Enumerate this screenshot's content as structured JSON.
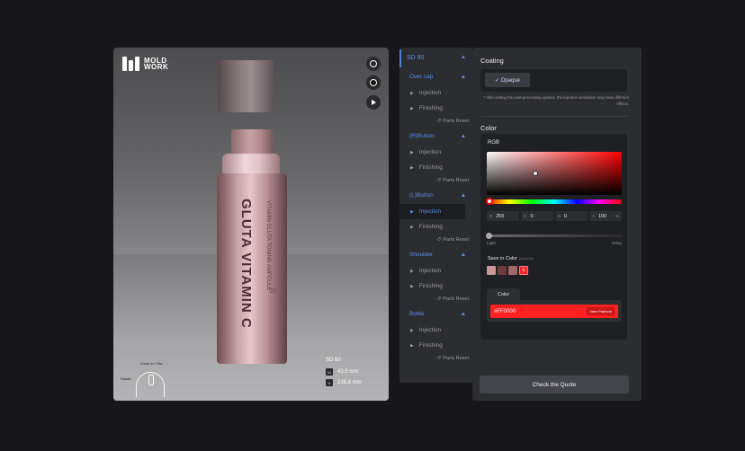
{
  "brand": {
    "line1": "MOLD",
    "line2": "WORK"
  },
  "viewer": {
    "bottle_title": "GLUTA VITAMIN C",
    "bottle_small_text": "VITAMIN GLUTA TONING AMPOULE",
    "bottle_number": "10",
    "zoom_label": "Zoom In / Out",
    "rotate_label": "Rotate",
    "model": "SD 80",
    "width_key": "W",
    "width_value": "43.5 mm",
    "height_key": "H",
    "height_value": "135.8 mm",
    "icons": [
      "label-icon",
      "color-dot-icon",
      "play-icon"
    ]
  },
  "parts": {
    "model": "SD 80",
    "items": [
      {
        "name": "Over cap",
        "injection": "Injection",
        "finishing": "Finishing",
        "reset": "Parts Reset"
      },
      {
        "name": "(R)Button",
        "injection": "Injection",
        "finishing": "Finishing",
        "reset": "Parts Reset"
      },
      {
        "name": "(L)Button",
        "injection": "Injection",
        "finishing": "Finishing",
        "reset": "Parts Reset"
      },
      {
        "name": "Shoulder",
        "injection": "Injection",
        "finishing": "Finishing",
        "reset": "Parts Reset"
      },
      {
        "name": "Bottle",
        "injection": "Injection",
        "finishing": "Finishing",
        "reset": "Parts Reset"
      }
    ],
    "active_part": "(L)Button",
    "active_option": "Injection"
  },
  "coating": {
    "title": "Coating",
    "option": "✓ Opaque",
    "note": "* After setting the post-processing options, the injection simulation may have different effects."
  },
  "color": {
    "title": "Color",
    "mode": "RGB",
    "r_label": "R",
    "r": "255",
    "g_label": "G",
    "g": "0",
    "b_label": "B",
    "b": "0",
    "a_label": "A",
    "a": "100",
    "a_unit": "%",
    "light": "Light",
    "deep": "Deep",
    "save_label": "Save in Color",
    "save_hint": "(Up to 10)",
    "swatches": [
      "#c99597",
      "#6e3b3d",
      "#a2686a"
    ],
    "add_symbol": "+",
    "tab_label": "Color",
    "hex": "#FF0000",
    "palette_button": "View Pantone",
    "selected_color": "#ff2020"
  },
  "actions": {
    "quote": "Check the Quote"
  }
}
